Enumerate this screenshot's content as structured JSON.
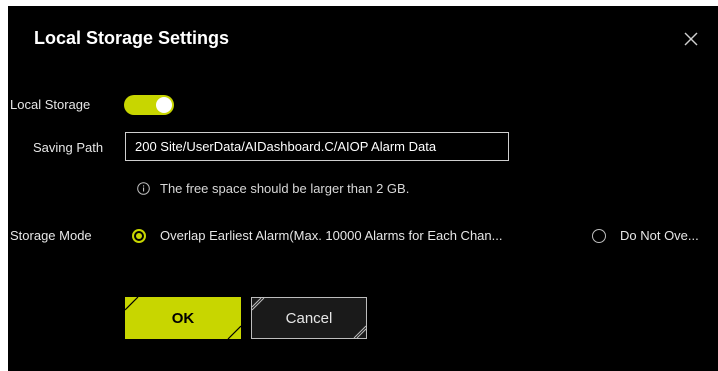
{
  "dialog": {
    "title": "Local Storage Settings",
    "close_icon": "close-icon"
  },
  "local_storage": {
    "label": "Local Storage",
    "enabled": true,
    "toggle_color": "#c8d600"
  },
  "saving_path": {
    "label": "Saving Path",
    "value": "200 Site/UserData/AIDashboard.C/AIOP Alarm Data",
    "hint_icon": "info-icon",
    "hint": "The free space should be larger than 2 GB."
  },
  "storage_mode": {
    "label": "Storage Mode",
    "options": [
      {
        "label": "Overlap Earliest Alarm(Max. 10000 Alarms for Each Chan...",
        "selected": true
      },
      {
        "label": "Do Not Ove...",
        "selected": false
      }
    ]
  },
  "buttons": {
    "ok": "OK",
    "cancel": "Cancel"
  },
  "colors": {
    "accent": "#c8d600",
    "background": "#000000"
  }
}
